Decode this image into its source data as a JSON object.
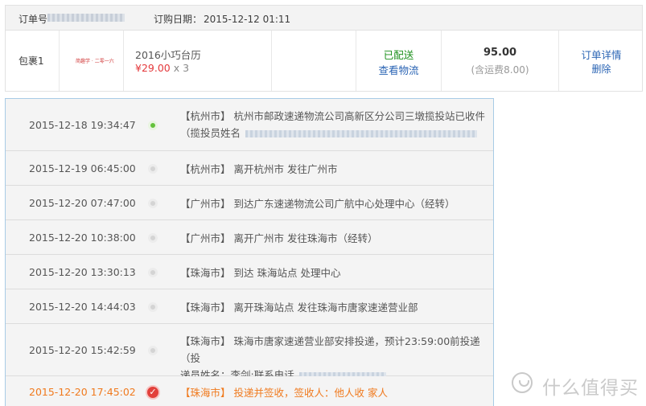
{
  "order": {
    "order_no_label": "订单号",
    "date_label": "订购日期：",
    "date_value": "2015-12-12 01:11"
  },
  "package": {
    "label": "包裹1",
    "thumb_text": "简趣学 · 二零一六",
    "product_name": "2016小巧台历",
    "price": "¥29.00",
    "quantity": "x 3",
    "status": "已配送",
    "logistics_link": "查看物流",
    "total": "95.00",
    "shipping_note": "(含运费8.00)",
    "detail_link": "订单详情",
    "delete_link": "删除"
  },
  "tracking": [
    {
      "time": "2015-12-18 19:34:47",
      "city": "【杭州市】",
      "text": "杭州市邮政速递物流公司高新区分公司三墩揽投站已收件",
      "line2": "（揽投员姓名",
      "dot": "green"
    },
    {
      "time": "2015-12-19 06:45:00",
      "city": "【杭州市】",
      "text": "离开杭州市 发往广州市",
      "dot": "gray"
    },
    {
      "time": "2015-12-20 07:47:00",
      "city": "【广州市】",
      "text": "到达广东速递物流公司广航中心处理中心（经转）",
      "dot": "gray"
    },
    {
      "time": "2015-12-20 10:38:00",
      "city": "【广州市】",
      "text": "离开广州市 发往珠海市（经转）",
      "dot": "gray"
    },
    {
      "time": "2015-12-20 13:30:13",
      "city": "【珠海市】",
      "text": "到达 珠海站点 处理中心",
      "dot": "gray"
    },
    {
      "time": "2015-12-20 14:44:03",
      "city": "【珠海市】",
      "text": "离开珠海站点 发往珠海市唐家速递营业部",
      "dot": "gray"
    },
    {
      "time": "2015-12-20 15:42:59",
      "city": "【珠海市】",
      "text": "珠海市唐家速递营业部安排投递，预计23:59:00前投递（投",
      "line2": "递员姓名：李剑;联系电话",
      "dot": "gray"
    },
    {
      "time": "2015-12-20 17:45:02",
      "city": "【珠海市】",
      "text": "投递并签收，签收人：他人收 家人",
      "dot": "check"
    }
  ],
  "watermark": {
    "text": "什么值得买",
    "logo_icon": "smzdm-logo-icon"
  },
  "colors": {
    "accent_link": "#2a64b4",
    "status_green": "#1a8f1a",
    "price_red": "#e4393c",
    "latest_orange": "#f07a1e",
    "timeline_border": "#a8cbe6"
  }
}
